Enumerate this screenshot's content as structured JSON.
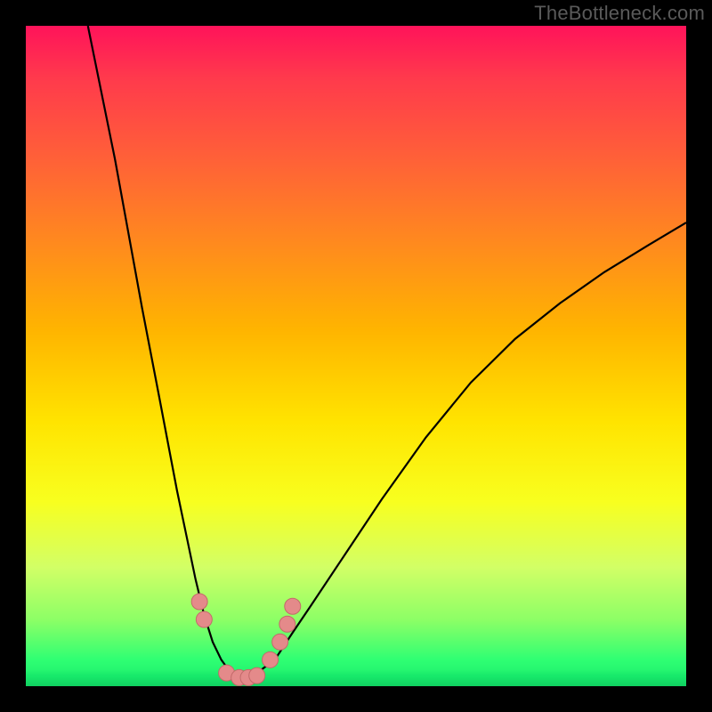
{
  "watermark_text": "TheBottleneck.com",
  "colors": {
    "frame_bg": "#000000",
    "curve_stroke": "#000000",
    "marker_fill": "#e48a8a",
    "marker_stroke": "#c36a6a",
    "gradient_top": "#ff135a",
    "gradient_bottom": "#17e86a"
  },
  "chart_data": {
    "type": "line",
    "title": "",
    "subtitle": "",
    "xlabel": "",
    "ylabel": "",
    "xlim": [
      0,
      100
    ],
    "ylim": [
      0,
      100
    ],
    "legend": null,
    "grid": false,
    "annotations": [],
    "note": "Axis values are normalized 0–100 estimates read from position within the plot area (no tick labels are present in the image). y=0 is the curve minimum (green band); y=100 is the top (red band). Two curve branches form a V shape meeting near x≈32.",
    "series": [
      {
        "name": "left_branch",
        "x": [
          9.4,
          13.5,
          17.6,
          20.2,
          22.9,
          24.3,
          25.7,
          27.0,
          28.3,
          29.6,
          30.9,
          32.3
        ],
        "y": [
          100.0,
          79.8,
          57.3,
          43.8,
          29.6,
          22.9,
          16.2,
          10.8,
          6.7,
          4.0,
          2.2,
          0.9
        ]
      },
      {
        "name": "right_branch",
        "x": [
          32.3,
          35.0,
          37.7,
          40.4,
          43.1,
          48.5,
          53.9,
          60.6,
          67.4,
          74.1,
          80.9,
          87.6,
          94.3,
          100.0
        ],
        "y": [
          0.9,
          2.0,
          4.0,
          8.1,
          12.1,
          20.2,
          28.3,
          37.7,
          46.0,
          52.6,
          58.0,
          62.7,
          66.8,
          70.2
        ]
      }
    ],
    "markers": {
      "name": "highlight_points",
      "note": "Salmon-colored circular markers clustered near the minimum on both branches.",
      "points": [
        {
          "x": 26.3,
          "y": 12.8
        },
        {
          "x": 27.0,
          "y": 10.1
        },
        {
          "x": 30.4,
          "y": 2.0
        },
        {
          "x": 32.3,
          "y": 1.3
        },
        {
          "x": 33.7,
          "y": 1.3
        },
        {
          "x": 35.0,
          "y": 1.6
        },
        {
          "x": 37.0,
          "y": 4.0
        },
        {
          "x": 38.5,
          "y": 6.7
        },
        {
          "x": 39.6,
          "y": 9.4
        },
        {
          "x": 40.4,
          "y": 12.1
        }
      ]
    }
  }
}
